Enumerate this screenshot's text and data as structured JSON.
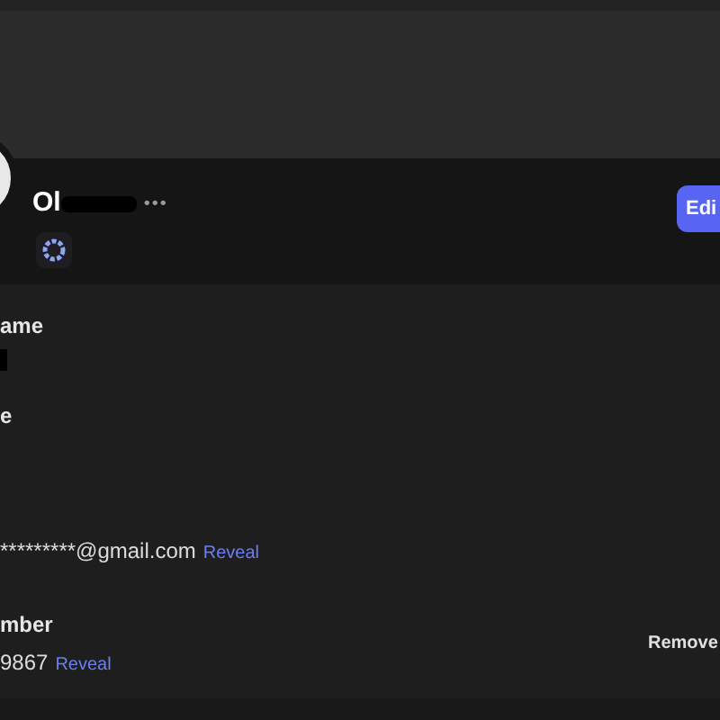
{
  "profile": {
    "username": "Ol",
    "more": "•••",
    "edit_button": "Edi"
  },
  "fields": [
    {
      "label": "ame"
    },
    {
      "label": "e"
    },
    {
      "value": "*********@gmail.com",
      "link": "Reveal"
    },
    {
      "label": "mber",
      "value": "9867",
      "link": "Reveal",
      "action": "Remove"
    }
  ]
}
